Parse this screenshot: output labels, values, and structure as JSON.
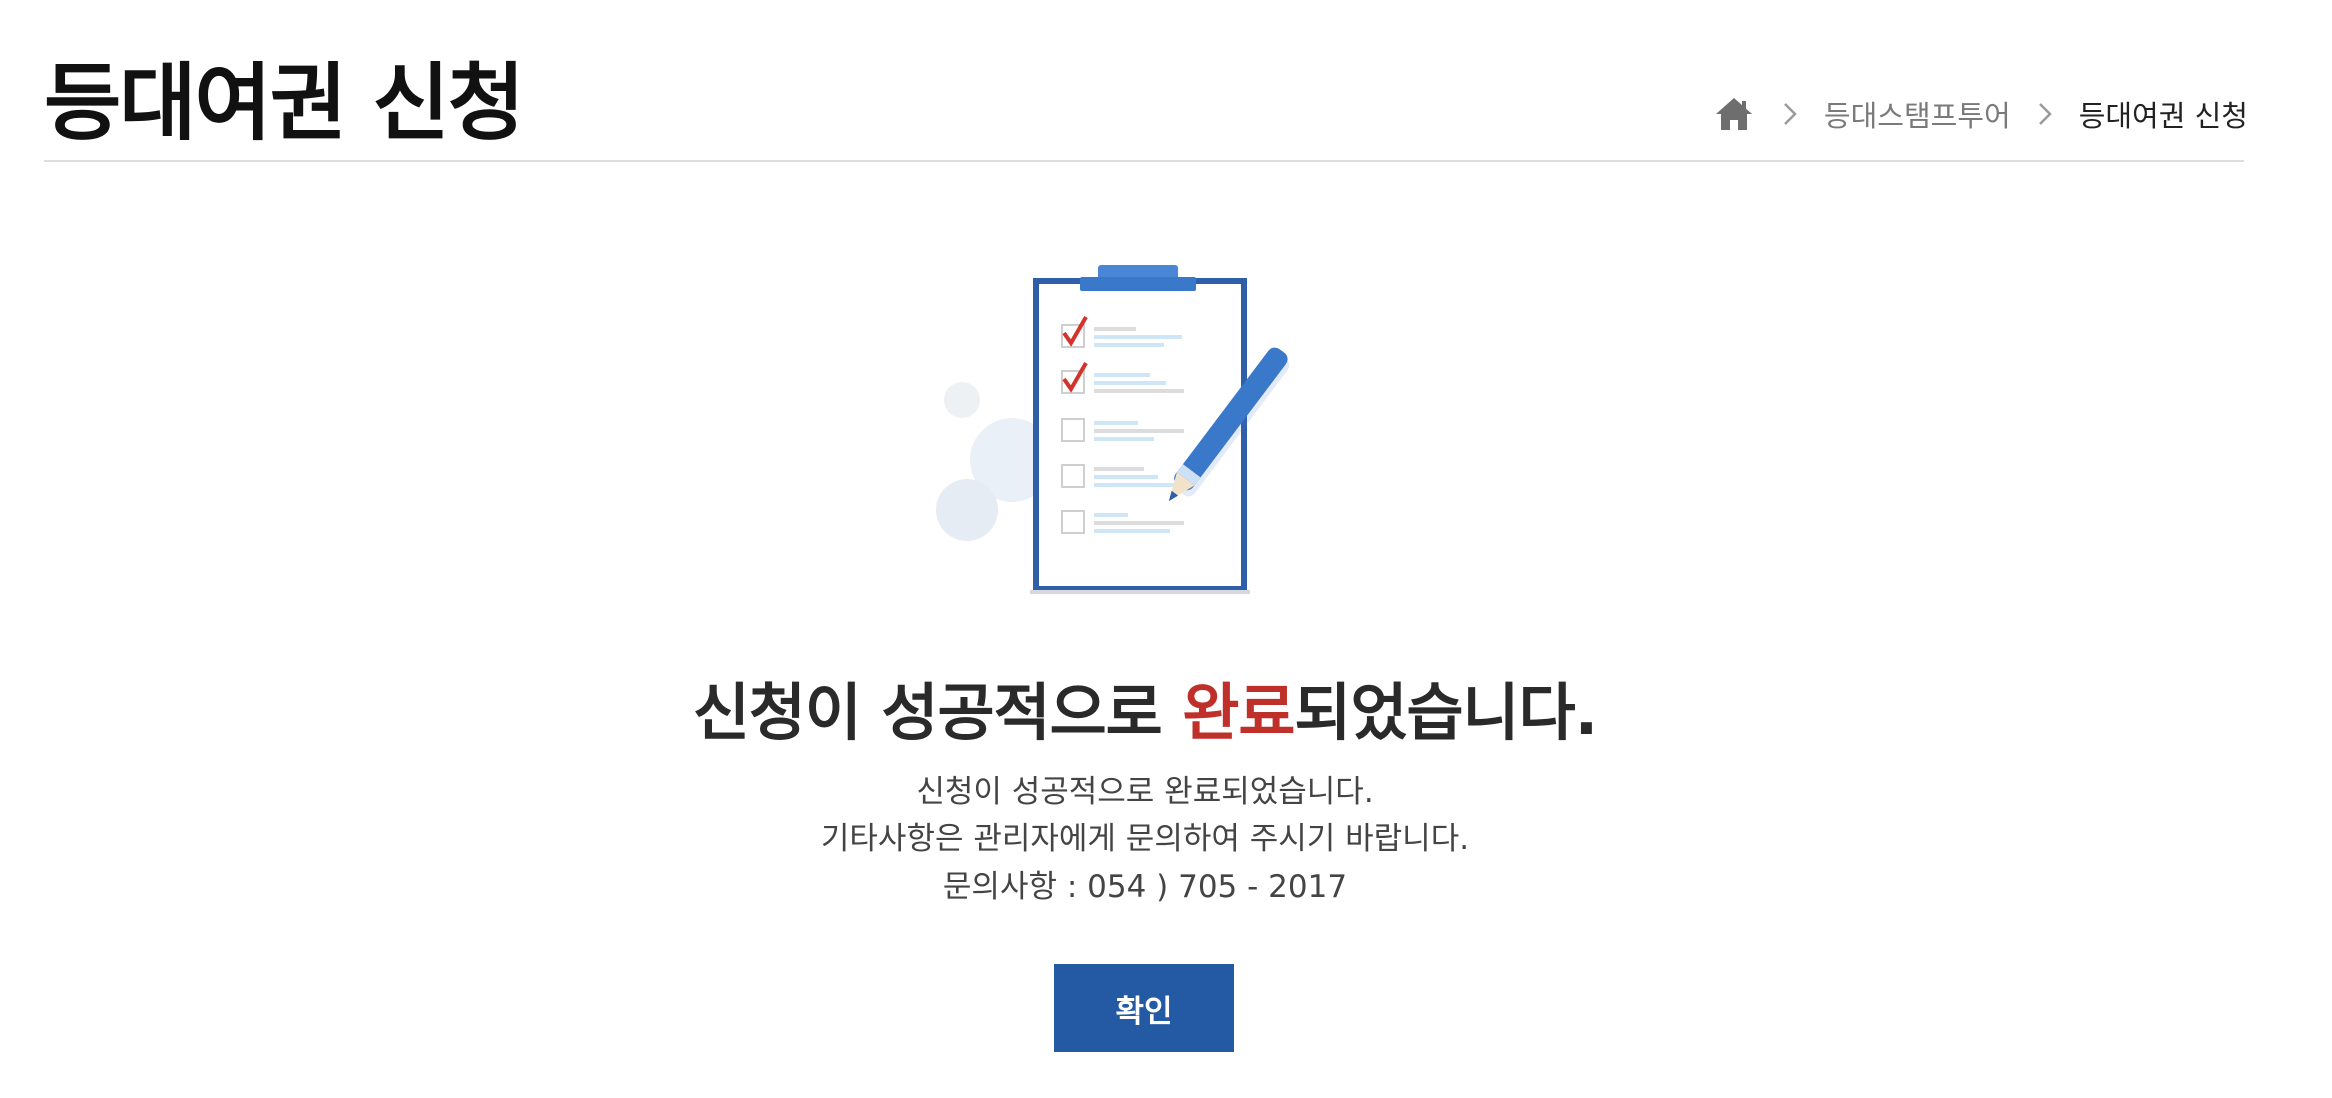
{
  "header": {
    "title": "등대여권 신청",
    "breadcrumb": [
      "등대스탬프투어",
      "등대여권 신청"
    ]
  },
  "icons": {
    "home": "home-icon",
    "separator": "chevron-right-icon",
    "illustration": "clipboard-checklist-icon"
  },
  "result": {
    "message_before": "신청이 성공적으로 ",
    "message_accent": "완료",
    "message_after": "되었습니다.",
    "lines": [
      "신청이 성공적으로 완료되었습니다.",
      "기타사항은 관리자에게 문의하여 주시기 바랍니다.",
      "문의사항 : 054 ) 705 - 2017"
    ]
  },
  "confirm_label": "확인",
  "colors": {
    "accent": "#c0302a",
    "button": "#235aa3",
    "clipboard": "#2f5fa8",
    "pencil": "#3a78c9"
  }
}
